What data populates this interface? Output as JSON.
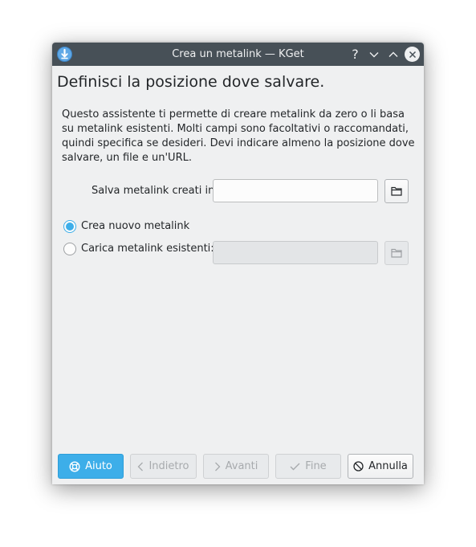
{
  "window": {
    "title": "Crea un metalink — KGet",
    "help_glyph": "?",
    "icons": [
      "kget-icon",
      "help-icon",
      "minimize-icon",
      "maximize-icon",
      "close-icon"
    ]
  },
  "page": {
    "heading": "Definisci la posizione dove salvare.",
    "description": "Questo assistente ti permette di creare metalink da zero o li basa su metalink esistenti. Molti campi sono facoltativi o raccomandati, quindi specifica se desideri. Devi indicare almeno la posizione dove salvare, un file e un'URL."
  },
  "form": {
    "save_label": "Salva metalink creati in:",
    "save_value": "",
    "new_option": "Crea nuovo metalink",
    "new_selected": true,
    "load_option": "Carica metalink esistenti:",
    "load_value": ""
  },
  "buttons": {
    "help": "Aiuto",
    "back": "Indietro",
    "next": "Avanti",
    "finish": "Fine",
    "cancel": "Annulla"
  },
  "colors": {
    "accent": "#3daee9",
    "titlebar": "#475057",
    "background": "#eff0f1"
  }
}
